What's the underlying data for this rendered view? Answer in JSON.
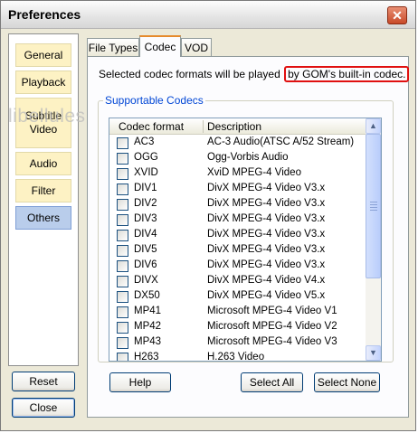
{
  "window": {
    "title": "Preferences",
    "close_glyph": "✕"
  },
  "nav": {
    "items": [
      {
        "label": "General",
        "name": "nav-item-general",
        "active": false
      },
      {
        "label": "Playback",
        "name": "nav-item-playback",
        "active": false
      },
      {
        "label": "Subtitle Video",
        "name": "nav-item-subtitle-video",
        "active": false
      },
      {
        "label": "Audio",
        "name": "nav-item-audio",
        "active": false
      },
      {
        "label": "Filter",
        "name": "nav-item-filter",
        "active": false
      },
      {
        "label": "Others",
        "name": "nav-item-others",
        "active": true
      }
    ]
  },
  "watermark": "libellules.ch",
  "tabs": [
    {
      "label": "File Types",
      "active": false
    },
    {
      "label": "Codec",
      "active": true
    },
    {
      "label": "VOD",
      "active": false
    }
  ],
  "info": {
    "prefix": "Selected codec formats will be played",
    "highlight": "by GOM's built-in codec."
  },
  "group": {
    "label": "Supportable Codecs"
  },
  "columns": {
    "format": "Codec format",
    "description": "Description"
  },
  "codecs": [
    {
      "format": "AC3",
      "description": "AC-3 Audio(ATSC A/52 Stream)"
    },
    {
      "format": "OGG",
      "description": "Ogg-Vorbis Audio"
    },
    {
      "format": "XVID",
      "description": "XviD MPEG-4 Video"
    },
    {
      "format": "DIV1",
      "description": "DivX MPEG-4 Video V3.x"
    },
    {
      "format": "DIV2",
      "description": "DivX MPEG-4 Video V3.x"
    },
    {
      "format": "DIV3",
      "description": "DivX MPEG-4 Video V3.x"
    },
    {
      "format": "DIV4",
      "description": "DivX MPEG-4 Video V3.x"
    },
    {
      "format": "DIV5",
      "description": "DivX MPEG-4 Video V3.x"
    },
    {
      "format": "DIV6",
      "description": "DivX MPEG-4 Video V3.x"
    },
    {
      "format": "DIVX",
      "description": "DivX MPEG-4 Video V4.x"
    },
    {
      "format": "DX50",
      "description": "DivX MPEG-4 Video V5.x"
    },
    {
      "format": "MP41",
      "description": "Microsoft MPEG-4 Video V1"
    },
    {
      "format": "MP42",
      "description": "Microsoft MPEG-4 Video V2"
    },
    {
      "format": "MP43",
      "description": "Microsoft MPEG-4 Video V3"
    },
    {
      "format": "H263",
      "description": "H.263 Video"
    }
  ],
  "scrollbar": {
    "up_glyph": "▲",
    "down_glyph": "▼"
  },
  "buttons": {
    "help": "Help",
    "select_all": "Select All",
    "select_none": "Select None",
    "reset": "Reset",
    "close": "Close"
  },
  "colors": {
    "highlight_border": "#e01010",
    "group_label": "#0046d5",
    "nav_item_bg": "#fdf2c4",
    "nav_active_bg": "#b9cdeb",
    "tab_active_accent": "#e68b2c"
  }
}
